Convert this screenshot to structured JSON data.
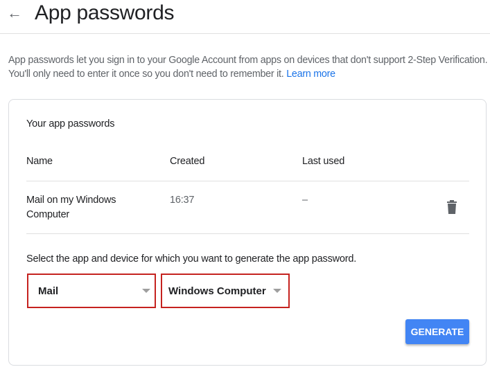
{
  "header": {
    "title": "App passwords",
    "back_icon": "arrow-left-icon"
  },
  "description": {
    "text": "App passwords let you sign in to your Google Account from apps on devices that don't support 2-Step Verification. You'll only need to enter it once so you don't need to remember it.",
    "link": "Learn more"
  },
  "card": {
    "title": "Your app passwords",
    "columns": [
      "Name",
      "Created",
      "Last used"
    ],
    "rows": [
      {
        "name_line1": "Mail on my Windows",
        "name_line2": "Computer",
        "created": "16:37",
        "last_used": "–"
      }
    ],
    "select_label": "Select the app and device for which you want to generate the app password.",
    "app_select": "Mail",
    "device_select": "Windows Computer",
    "generate": "GENERATE"
  },
  "colors": {
    "accent": "#4285f4",
    "highlight": "#c5221f",
    "link": "#1a73e8"
  }
}
